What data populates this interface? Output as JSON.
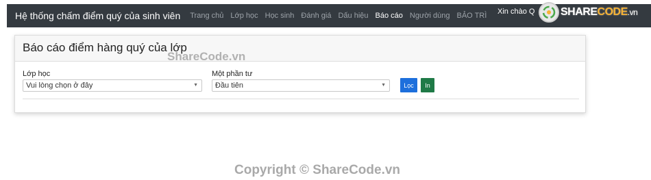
{
  "navbar": {
    "brand": "Hệ thống chấm điểm quý của sinh viên",
    "links": [
      {
        "label": "Trang chủ",
        "active": false
      },
      {
        "label": "Lớp học",
        "active": false
      },
      {
        "label": "Học sinh",
        "active": false
      },
      {
        "label": "Đánh giá",
        "active": false
      },
      {
        "label": "Dấu hiệu",
        "active": false
      },
      {
        "label": "Báo cáo",
        "active": true
      },
      {
        "label": "Người dùng",
        "active": false
      },
      {
        "label": "BẢO TRÌ",
        "active": false
      }
    ],
    "greeting": "Xin chào Q"
  },
  "logo": {
    "text_main": "SHARE",
    "text_accent": "CODE",
    "text_tld": ".vn"
  },
  "card": {
    "title": "Báo cáo điểm hàng quý của lớp",
    "class_label": "Lớp học",
    "class_select_value": "Vui lòng chọn ở đây",
    "term_label": "Một phần tư",
    "term_select_value": "Đầu tiên",
    "filter_button": "Lọc",
    "print_button": "In"
  },
  "watermarks": {
    "top": "ShareCode.vn",
    "bottom": "Copyright © ShareCode.vn"
  },
  "colors": {
    "navbar_bg": "#343a40",
    "primary": "#1d6fdc",
    "success": "#1f7a47"
  }
}
